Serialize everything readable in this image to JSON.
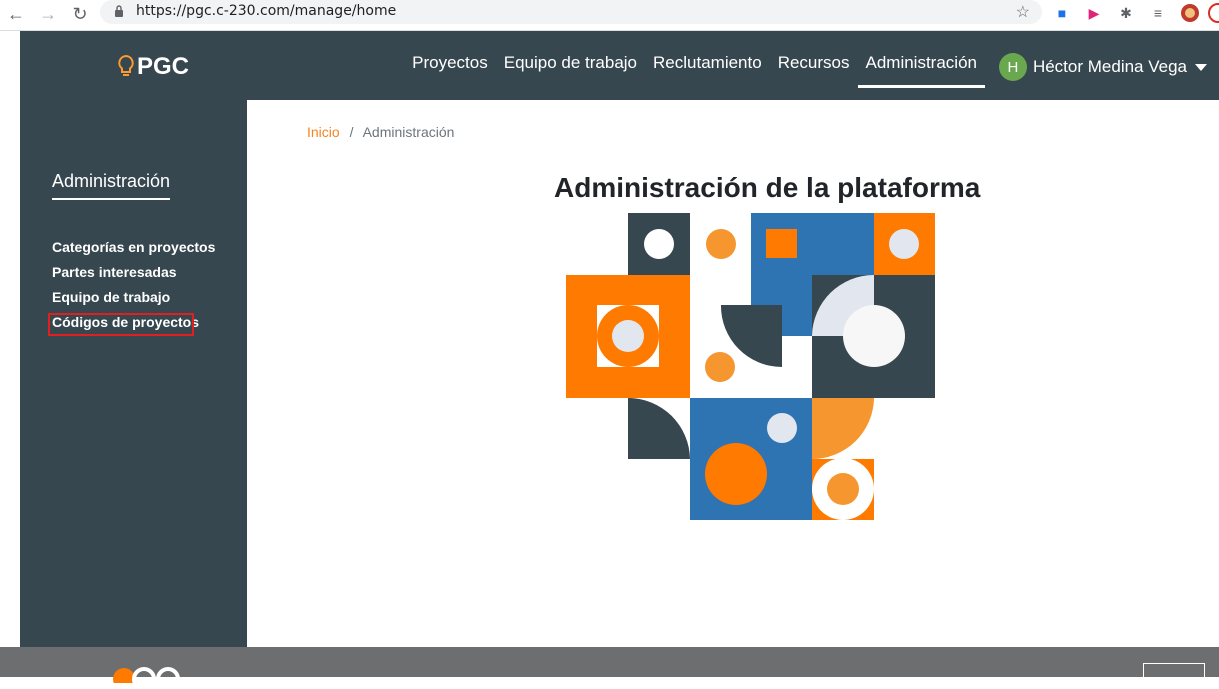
{
  "browser": {
    "url": "https://pgc.c-230.com/manage/home"
  },
  "header": {
    "logo_text": "PGC",
    "nav": [
      {
        "label": "Proyectos"
      },
      {
        "label": "Equipo de trabajo"
      },
      {
        "label": "Reclutamiento"
      },
      {
        "label": "Recursos"
      },
      {
        "label": "Administración"
      }
    ],
    "active_nav": "Administración",
    "user_initial": "H",
    "user_name": "Héctor Medina Vega"
  },
  "sidebar": {
    "title": "Administración",
    "links": [
      {
        "label": "Categorías en proyectos"
      },
      {
        "label": "Partes interesadas"
      },
      {
        "label": "Equipo de trabajo"
      },
      {
        "label": "Códigos de proyectos"
      }
    ]
  },
  "breadcrumb": {
    "home": "Inicio",
    "separator": "/",
    "current": "Administración"
  },
  "main": {
    "title": "Administración de la plataforma"
  },
  "colors": {
    "dark": "#37474f",
    "orange": "#ff7a00",
    "light_orange": "#f5962f",
    "blue": "#2f74b2",
    "light": "#e2e7ef",
    "accent": "#f5831f"
  }
}
